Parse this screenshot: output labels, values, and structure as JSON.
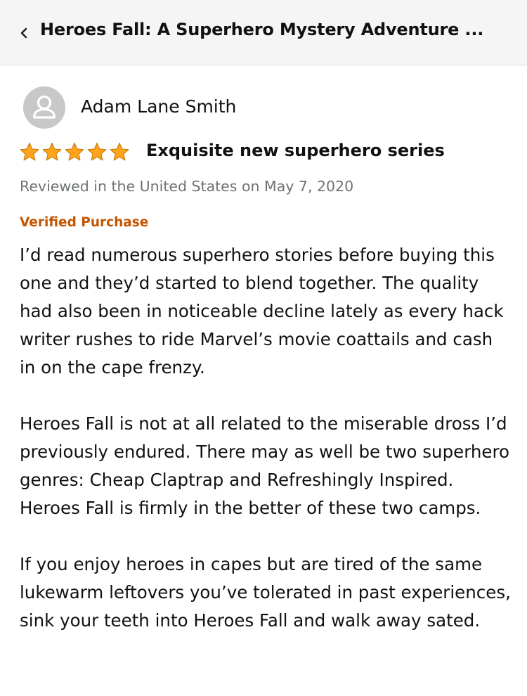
{
  "header": {
    "title": "Heroes Fall: A Superhero Mystery Adventure ..."
  },
  "review": {
    "reviewer_name": "Adam Lane Smith",
    "rating": 5,
    "rating_max": 5,
    "title": "Exquisite new superhero series",
    "meta": "Reviewed in the United States on May 7, 2020",
    "verified": "Verified Purchase",
    "paragraphs": [
      "I’d read numerous superhero stories before buying this one and they’d started to blend together. The quality had also been in noticeable decline lately as every hack writer rushes to ride Marvel’s movie coattails and cash in on the cape frenzy.",
      "Heroes Fall is not at all related to the miserable dross I’d previously endured. There may as well be two superhero genres: Cheap Claptrap and Refreshingly Inspired. Heroes Fall is firmly in the better of these two camps.",
      "If you enjoy heroes in capes but are tired of the same lukewarm leftovers you’ve tolerated in past experiences, sink your teeth into Heroes Fall and walk away sated."
    ]
  },
  "colors": {
    "header_bg": "#f5f5f5",
    "star": "#ffa41c",
    "verified": "#c45500",
    "meta": "#6f7373"
  },
  "icons": {
    "back": "chevron-left-icon",
    "avatar": "user-avatar-icon",
    "star": "star-icon"
  }
}
